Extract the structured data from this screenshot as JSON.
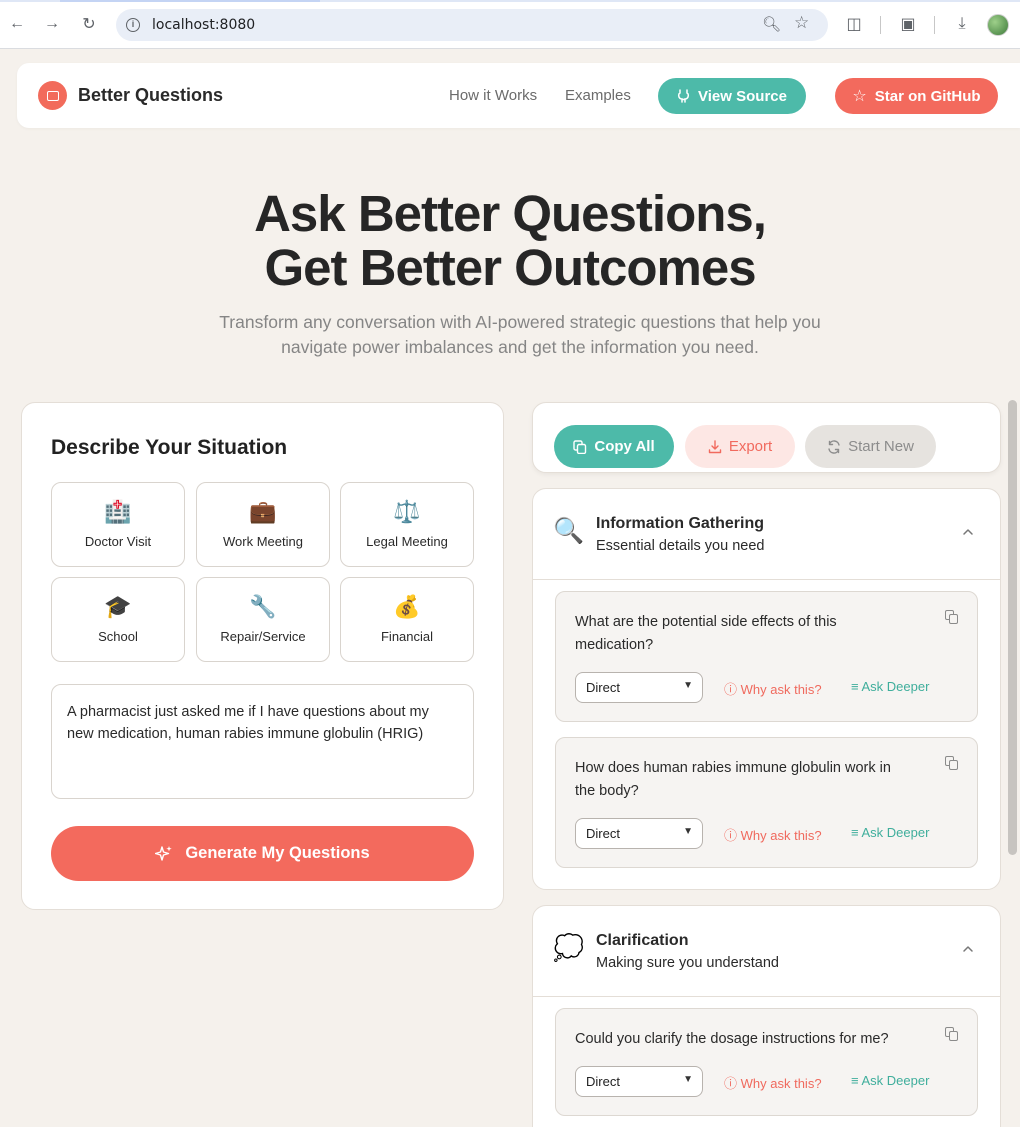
{
  "browser": {
    "url": "localhost:8080"
  },
  "nav": {
    "brand": "Better Questions",
    "links": [
      "How it Works",
      "Examples"
    ],
    "view_source": "View Source",
    "star_github": "Star on GitHub"
  },
  "hero": {
    "line1": "Ask Better Questions,",
    "line2": "Get Better Outcomes",
    "subtitle": "Transform any conversation with AI-powered strategic questions that help you navigate power imbalances and get the information you need."
  },
  "situation": {
    "title": "Describe Your Situation",
    "tiles": [
      {
        "emoji": "🏥",
        "label": "Doctor Visit"
      },
      {
        "emoji": "💼",
        "label": "Work Meeting"
      },
      {
        "emoji": "⚖️",
        "label": "Legal Meeting"
      },
      {
        "emoji": "🎓",
        "label": "School"
      },
      {
        "emoji": "🔧",
        "label": "Repair/Service"
      },
      {
        "emoji": "💰",
        "label": "Financial"
      }
    ],
    "input_value": "A pharmacist just asked me if I have questions about my new medication, human rabies immune globulin (HRIG)",
    "generate_label": "Generate My Questions"
  },
  "toolbar": {
    "copy_all": "Copy All",
    "export": "Export",
    "start_new": "Start New"
  },
  "groups": [
    {
      "emoji": "🔍",
      "title": "Information Gathering",
      "description": "Essential details you need",
      "questions": [
        {
          "text": "What are the potential side effects of this medication?",
          "style": "Direct",
          "why": "Why ask this?",
          "deeper": "Ask Deeper"
        },
        {
          "text": "How does human rabies immune globulin work in the body?",
          "style": "Direct",
          "why": "Why ask this?",
          "deeper": "Ask Deeper"
        }
      ]
    },
    {
      "emoji": "💭",
      "title": "Clarification",
      "description": "Making sure you understand",
      "questions": [
        {
          "text": "Could you clarify the dosage instructions for me?",
          "style": "Direct",
          "why": "Why ask this?",
          "deeper": "Ask Deeper"
        }
      ]
    }
  ],
  "colors": {
    "accent_coral": "#f36a5d",
    "accent_teal": "#4dbaa9",
    "background": "#f5f1ec"
  }
}
